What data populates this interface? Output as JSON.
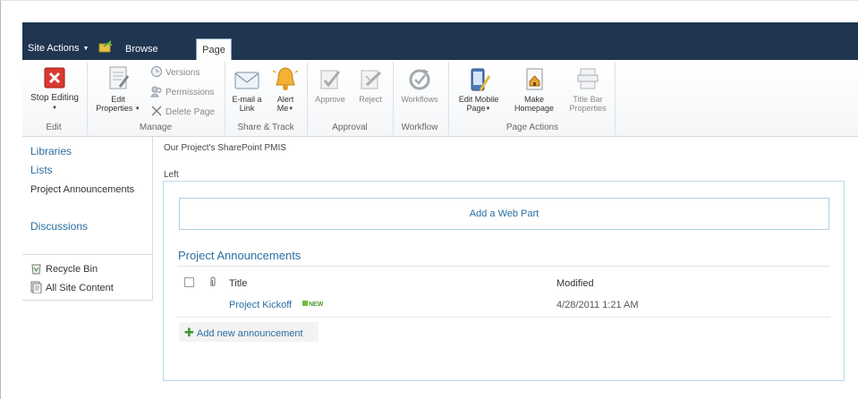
{
  "topbar": {
    "site_actions": "Site Actions",
    "tab_browse": "Browse",
    "tab_page": "Page"
  },
  "ribbon": {
    "edit": {
      "stop_editing": "Stop Editing",
      "group_label": "Edit"
    },
    "manage": {
      "edit_properties_1": "Edit",
      "edit_properties_2": "Properties",
      "versions": "Versions",
      "permissions": "Permissions",
      "delete_page": "Delete Page",
      "group_label": "Manage"
    },
    "share_track": {
      "email_link_1": "E-mail a",
      "email_link_2": "Link",
      "alert_me_1": "Alert",
      "alert_me_2": "Me",
      "group_label": "Share & Track"
    },
    "approval": {
      "approve": "Approve",
      "reject": "Reject",
      "group_label": "Approval"
    },
    "workflow": {
      "workflows": "Workflows",
      "group_label": "Workflow"
    },
    "page_actions": {
      "edit_mobile_1": "Edit Mobile",
      "edit_mobile_2": "Page",
      "make_homepage_1": "Make",
      "make_homepage_2": "Homepage",
      "title_bar_1": "Title Bar",
      "title_bar_2": "Properties",
      "group_label": "Page Actions"
    }
  },
  "leftnav": {
    "libraries": "Libraries",
    "lists": "Lists",
    "project_announcements": "Project Announcements",
    "discussions": "Discussions",
    "recycle_bin": "Recycle Bin",
    "all_site_content": "All Site Content"
  },
  "main": {
    "breadcrumb": "Our Project's SharePoint PMIS",
    "zone_title": "Left",
    "add_web_part": "Add a Web Part",
    "webpart": {
      "title": "Project Announcements",
      "columns": [
        "Title",
        "Modified"
      ],
      "rows": [
        {
          "title": "Project Kickoff",
          "badge": "NEW",
          "modified": "4/28/2011 1:21 AM"
        }
      ],
      "add_new": "Add new announcement"
    }
  },
  "colors": {
    "topbar": "#1f3550",
    "link": "#2b6ea0",
    "zone_border": "#bcd9e8"
  }
}
